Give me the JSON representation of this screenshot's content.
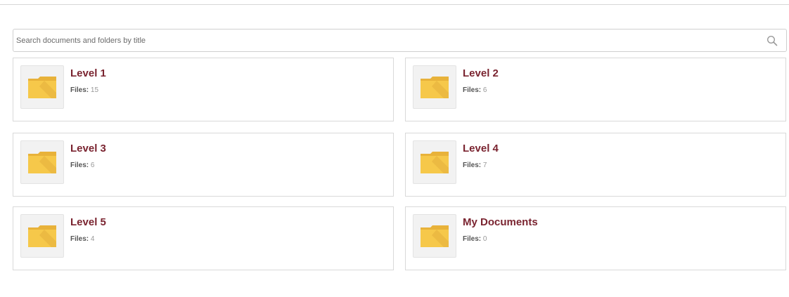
{
  "search": {
    "placeholder": "Search documents and folders by title"
  },
  "folders": [
    {
      "title": "Level 1",
      "files_label": "Files:",
      "files_count": "15"
    },
    {
      "title": "Level 2",
      "files_label": "Files:",
      "files_count": "6"
    },
    {
      "title": "Level 3",
      "files_label": "Files:",
      "files_count": "6"
    },
    {
      "title": "Level 4",
      "files_label": "Files:",
      "files_count": "7"
    },
    {
      "title": "Level 5",
      "files_label": "Files:",
      "files_count": "4"
    },
    {
      "title": "My Documents",
      "files_label": "Files:",
      "files_count": "0"
    }
  ],
  "colors": {
    "title": "#7a2430",
    "folder_body": "#f6c84a",
    "folder_tab": "#e8b23a"
  },
  "icons": {
    "search": "search-icon",
    "folder": "folder-icon"
  }
}
